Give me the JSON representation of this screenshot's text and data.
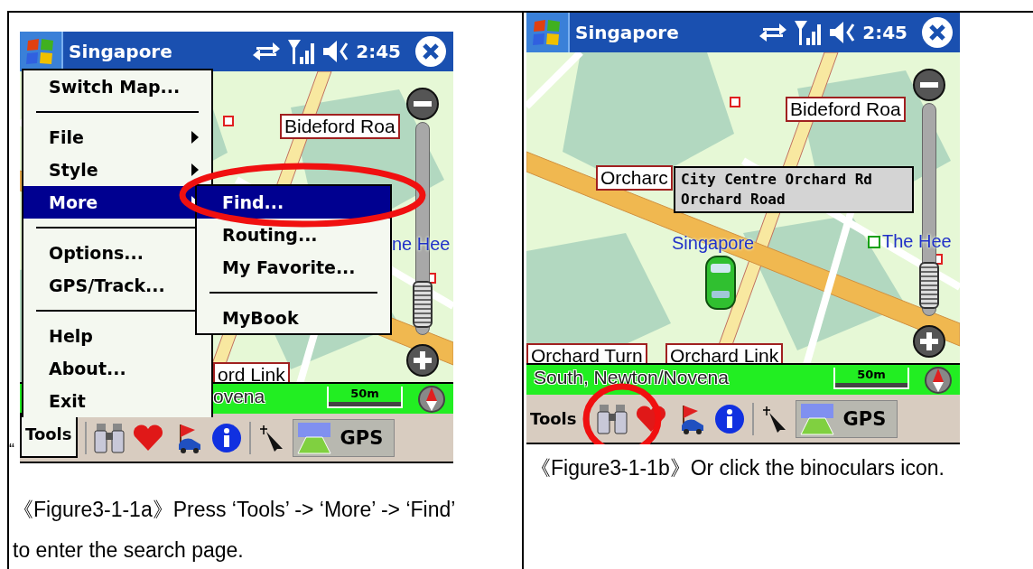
{
  "figures": [
    {
      "device": {
        "title": "Singapore",
        "time": "2:45",
        "map_labels": [
          {
            "kind": "road_sign",
            "text": "Bideford Roa"
          },
          {
            "kind": "place",
            "text": "ne Hee",
            "poi": false
          },
          {
            "kind": "road_sign",
            "text": "ord Link"
          }
        ],
        "zoom": {
          "level": 0.95
        },
        "status": {
          "lines": [
            "ovena"
          ],
          "scale": "50m"
        },
        "toolbar": {
          "tools": "Tools",
          "tools_open": true,
          "gps": "GPS"
        },
        "menu": {
          "items": [
            {
              "kind": "item",
              "label": "Switch Map...",
              "submenu": false,
              "selected": false
            },
            {
              "kind": "separator"
            },
            {
              "kind": "item",
              "label": "File",
              "submenu": true,
              "selected": false
            },
            {
              "kind": "item",
              "label": "Style",
              "submenu": true,
              "selected": false
            },
            {
              "kind": "item",
              "label": "More",
              "submenu": true,
              "selected": true
            },
            {
              "kind": "separator"
            },
            {
              "kind": "item",
              "label": "Options...",
              "submenu": false,
              "selected": false
            },
            {
              "kind": "item",
              "label": "GPS/Track...",
              "submenu": false,
              "selected": false
            },
            {
              "kind": "separator"
            },
            {
              "kind": "item",
              "label": "Help",
              "submenu": false,
              "selected": false
            },
            {
              "kind": "item",
              "label": "About...",
              "submenu": false,
              "selected": false
            },
            {
              "kind": "item",
              "label": "Exit",
              "submenu": false,
              "selected": false
            }
          ]
        },
        "submenu": {
          "items": [
            {
              "kind": "item",
              "label": "Find...",
              "selected": true
            },
            {
              "kind": "item",
              "label": "Routing...",
              "selected": false
            },
            {
              "kind": "item",
              "label": "My Favorite...",
              "selected": false
            },
            {
              "kind": "separator"
            },
            {
              "kind": "item",
              "label": "MyBook",
              "selected": false
            }
          ]
        }
      },
      "stray_mark": "“",
      "caption": "《Figure3-1-1a》Press ‘Tools’ -> ‘More’ -> ‘Find’ to enter the search page."
    },
    {
      "device": {
        "title": "Singapore",
        "time": "2:45",
        "map_labels": [
          {
            "kind": "road_sign",
            "text": "Bideford Roa"
          },
          {
            "kind": "road_sign",
            "text": "Orcharc"
          },
          {
            "kind": "place",
            "text": "Singapore",
            "poi": false
          },
          {
            "kind": "place",
            "text": "The Hee",
            "poi": true
          },
          {
            "kind": "road_sign",
            "text": "Orchard Turn"
          },
          {
            "kind": "road_sign",
            "text": "Orchard Link"
          }
        ],
        "popup": {
          "lines": [
            "City Centre Orchard Rd",
            "Orchard Road"
          ]
        },
        "zoom": {
          "level": 0.95
        },
        "status": {
          "lines": [
            "South, Newton/Novena"
          ],
          "scale": "50m"
        },
        "toolbar": {
          "tools": "Tools",
          "tools_open": false,
          "gps": "GPS"
        }
      },
      "caption": "《Figure3-1-1b》Or click the binoculars icon."
    }
  ]
}
